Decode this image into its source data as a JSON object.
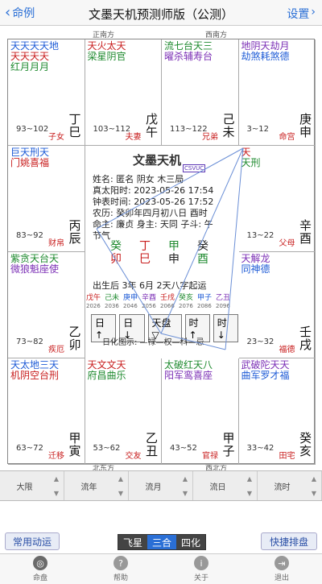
{
  "nav": {
    "back_label": "命例",
    "title": "文墨天机预测师版（公测）",
    "settings_label": "设置"
  },
  "directions": {
    "top_left": "正南方",
    "top_right": "西南方",
    "bottom_center": "北东方",
    "bottom_right": "西北方"
  },
  "cells": [
    {
      "id": "si",
      "stars": [
        "天天天天地",
        "天天天天",
        "红月月月"
      ],
      "age": "93~102",
      "stem": "丁巳",
      "palace": "子女"
    },
    {
      "id": "wu",
      "stars": [
        "天火太天",
        "梁星阴官"
      ],
      "age": "103~112",
      "stem": "戊午",
      "palace": "夫妻"
    },
    {
      "id": "wei",
      "stars": [
        "流七台天三",
        "曜杀辅寿台"
      ],
      "age": "113~122",
      "stem": "己未",
      "palace": "兄弟"
    },
    {
      "id": "shen",
      "stars": [
        "地阴天劫月",
        "劫煞耗煞德"
      ],
      "age": "3~12",
      "stem": "庚申",
      "palace": "命宫"
    },
    {
      "id": "chen",
      "stars": [
        "巨天刑天",
        "门姚喜福"
      ],
      "age": "83~92",
      "stem": "丙辰",
      "palace": "财帛"
    },
    {
      "id": "you",
      "stars": [
        "天",
        "天刑"
      ],
      "age": "13~22",
      "stem": "辛酉",
      "palace": "父母"
    },
    {
      "id": "mao",
      "stars": [
        "紫贪天台天",
        "微狼魁座使"
      ],
      "age": "73~82",
      "stem": "乙卯",
      "palace": "疾厄"
    },
    {
      "id": "xu",
      "stars": [
        "天解龙",
        "同神德"
      ],
      "age": "23~32",
      "stem": "壬戌",
      "palace": "福德"
    },
    {
      "id": "yin",
      "stars": [
        "天太地三天",
        "机阴空台刑"
      ],
      "age": "63~72",
      "stem": "甲寅",
      "palace": "迁移"
    },
    {
      "id": "chou",
      "stars": [
        "天文文天",
        "府昌曲乐"
      ],
      "age": "53~62",
      "stem": "乙丑",
      "palace": "交友"
    },
    {
      "id": "zi",
      "stars": [
        "太破红天八",
        "阳军鸾喜座"
      ],
      "age": "43~52",
      "stem": "甲子",
      "palace": "官禄"
    },
    {
      "id": "hai",
      "stars": [
        "武破陀天天",
        "曲军罗才福"
      ],
      "age": "33~42",
      "stem": "癸亥",
      "palace": "田宅"
    }
  ],
  "center": {
    "title": "文墨天机",
    "badge": "CSVUC",
    "lines": [
      "姓名: 匿名  阴女 木三局",
      "真太阳时: 2023-05-26 17:54",
      "钟表时间: 2023-05-26 17:52",
      "农历: 癸卯年四月初八日 酉时",
      "命主: 廉贞 身主: 天同 子斗: 午"
    ],
    "bazi_label": "节气",
    "bazi": [
      "癸",
      "丁",
      "甲",
      "癸"
    ],
    "bazi2": [
      "卯",
      "巳",
      "申",
      "酉"
    ],
    "luck_line": "出生后 3年 6月 2天八字起运",
    "luck_stems": [
      "戊午",
      "己未",
      "庚申",
      "辛酉",
      "壬戌",
      "癸亥",
      "甲子",
      "乙丑"
    ],
    "luck_years": [
      "2026",
      "2036",
      "2046",
      "2056",
      "2066",
      "2076",
      "2086",
      "2096"
    ],
    "ctrls": [
      "日↑",
      "日↓",
      "天盘▽",
      "时↑",
      "时↓"
    ],
    "sihua": "日化图示: —禄—权—科—忌"
  },
  "selectors": [
    "大限",
    "流年",
    "流月",
    "流日",
    "流时"
  ],
  "buttons": {
    "left": "常用动运",
    "right": "快捷排盘"
  },
  "segments": [
    "飞星",
    "三合",
    "四化"
  ],
  "active_segment": 1,
  "tabs": [
    {
      "label": "命盘",
      "icon": "chart-icon"
    },
    {
      "label": "帮助",
      "icon": "help-icon"
    },
    {
      "label": "关于",
      "icon": "info-icon"
    },
    {
      "label": "退出",
      "icon": "exit-icon"
    }
  ]
}
